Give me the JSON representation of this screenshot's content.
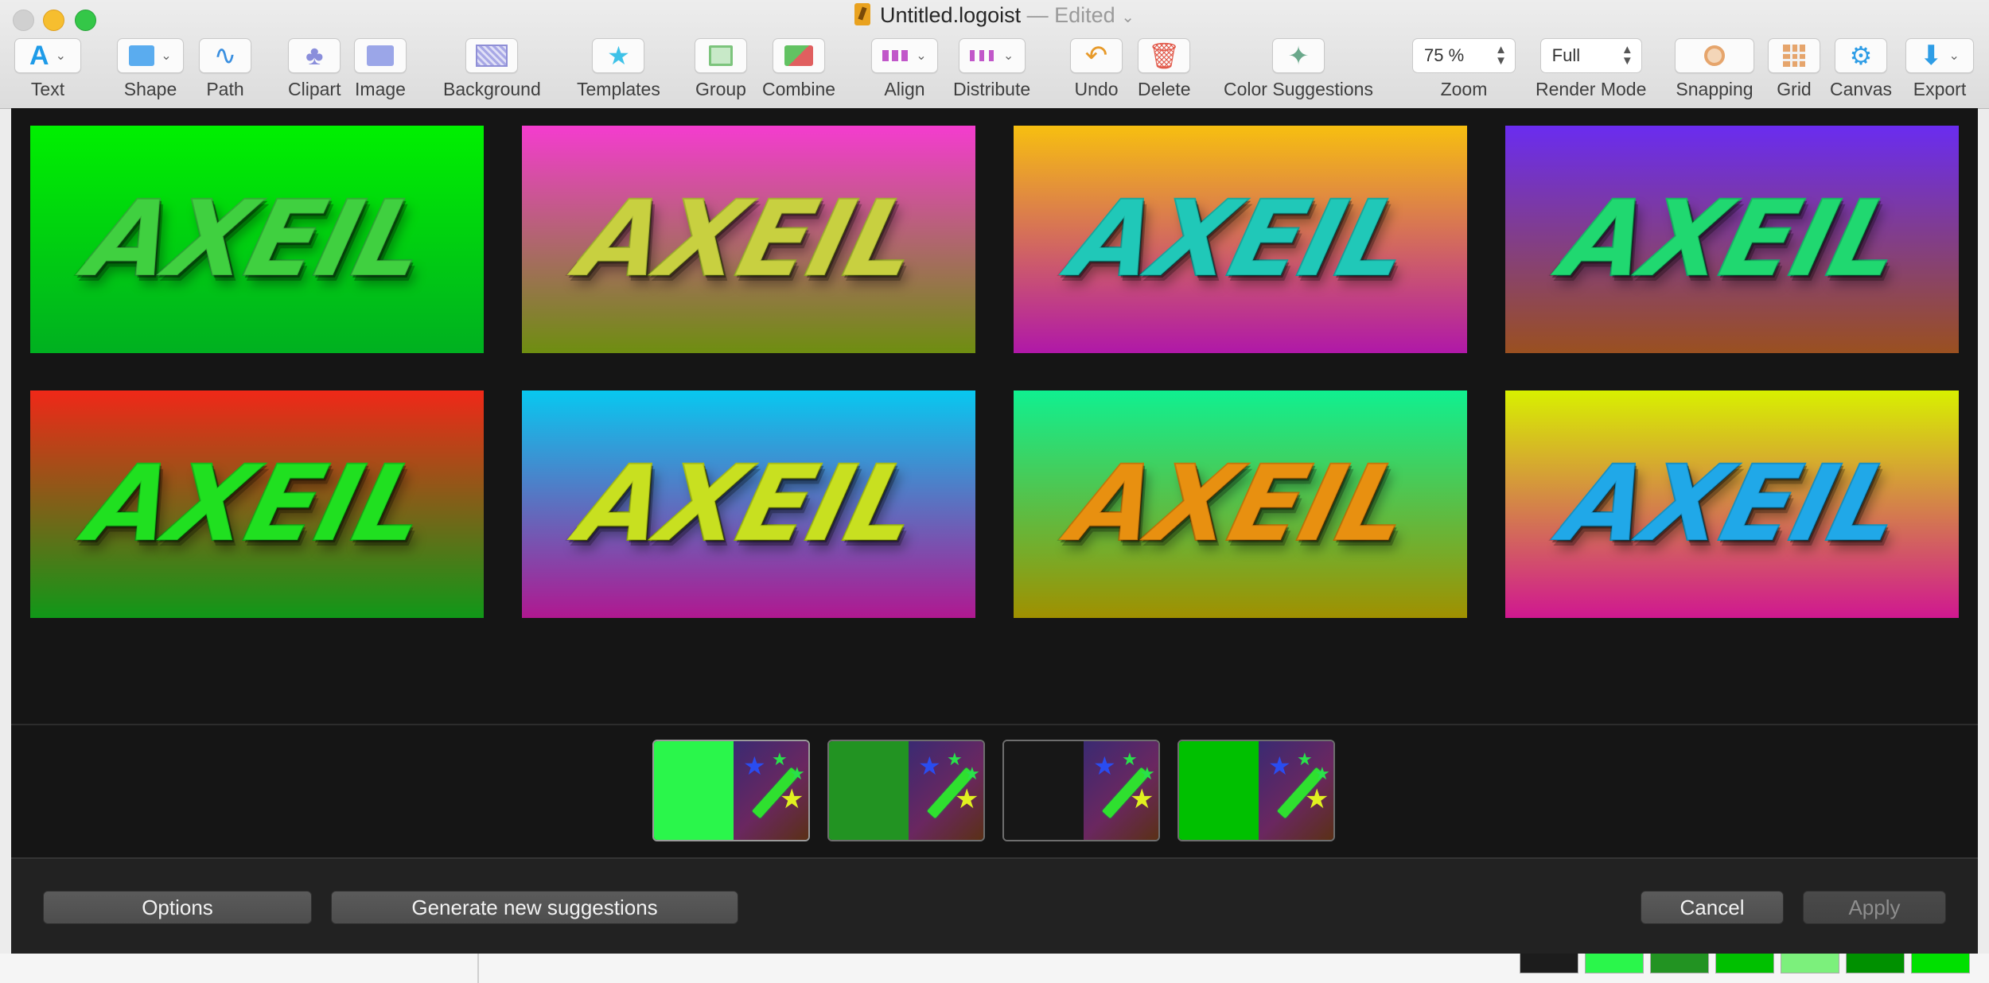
{
  "window": {
    "filename": "Untitled.logoist",
    "status": "— Edited"
  },
  "toolbar": {
    "text": "Text",
    "shape": "Shape",
    "path": "Path",
    "clipart": "Clipart",
    "image": "Image",
    "background": "Background",
    "templates": "Templates",
    "group": "Group",
    "combine": "Combine",
    "align": "Align",
    "distribute": "Distribute",
    "undo": "Undo",
    "delete": "Delete",
    "color_suggestions": "Color Suggestions",
    "zoom_label": "Zoom",
    "zoom_value": "75 %",
    "render_mode_label": "Render Mode",
    "render_mode_value": "Full",
    "snapping": "Snapping",
    "grid": "Grid",
    "canvas": "Canvas",
    "export": "Export"
  },
  "suggestions": [
    {
      "word": "AXEIL",
      "bg_top": "#00f000",
      "bg_bottom": "#00b020",
      "text_top": "#40d040",
      "text_bottom": "#20b040"
    },
    {
      "word": "AXEIL",
      "bg_top": "#f43ccf",
      "bg_bottom": "#6e8e10",
      "text_top": "#c8d040",
      "text_bottom": "#a0d020"
    },
    {
      "word": "AXEIL",
      "bg_top": "#f7bf10",
      "bg_bottom": "#b018a8",
      "text_top": "#20c8b8",
      "text_bottom": "#10b8c0"
    },
    {
      "word": "AXEIL",
      "bg_top": "#6a2cf0",
      "bg_bottom": "#9a5020",
      "text_top": "#20d870",
      "text_bottom": "#10c8a0"
    },
    {
      "word": "AXEIL",
      "bg_top": "#f02818",
      "bg_bottom": "#109818",
      "text_top": "#20e020",
      "text_bottom": "#10b010"
    },
    {
      "word": "AXEIL",
      "bg_top": "#08c8f0",
      "bg_bottom": "#b01890",
      "text_top": "#c8e020",
      "text_bottom": "#a0d000"
    },
    {
      "word": "AXEIL",
      "bg_top": "#10f090",
      "bg_bottom": "#a09000",
      "text_top": "#e89010",
      "text_bottom": "#d88000"
    },
    {
      "word": "AXEIL",
      "bg_top": "#d8f000",
      "bg_bottom": "#d01890",
      "text_top": "#20a8e8",
      "text_bottom": "#10b8d0"
    }
  ],
  "swatches": [
    {
      "color": "#2af64b",
      "selected": true
    },
    {
      "color": "#229322",
      "selected": false
    },
    {
      "color": "#171717",
      "selected": false
    },
    {
      "color": "#00c000",
      "selected": false
    }
  ],
  "footer": {
    "options": "Options",
    "generate": "Generate new suggestions",
    "cancel": "Cancel",
    "apply": "Apply"
  },
  "background_palette": [
    "#1c1c1c",
    "#2af64b",
    "#229322",
    "#00c000",
    "#7cf07c",
    "#009000",
    "#00e000"
  ]
}
